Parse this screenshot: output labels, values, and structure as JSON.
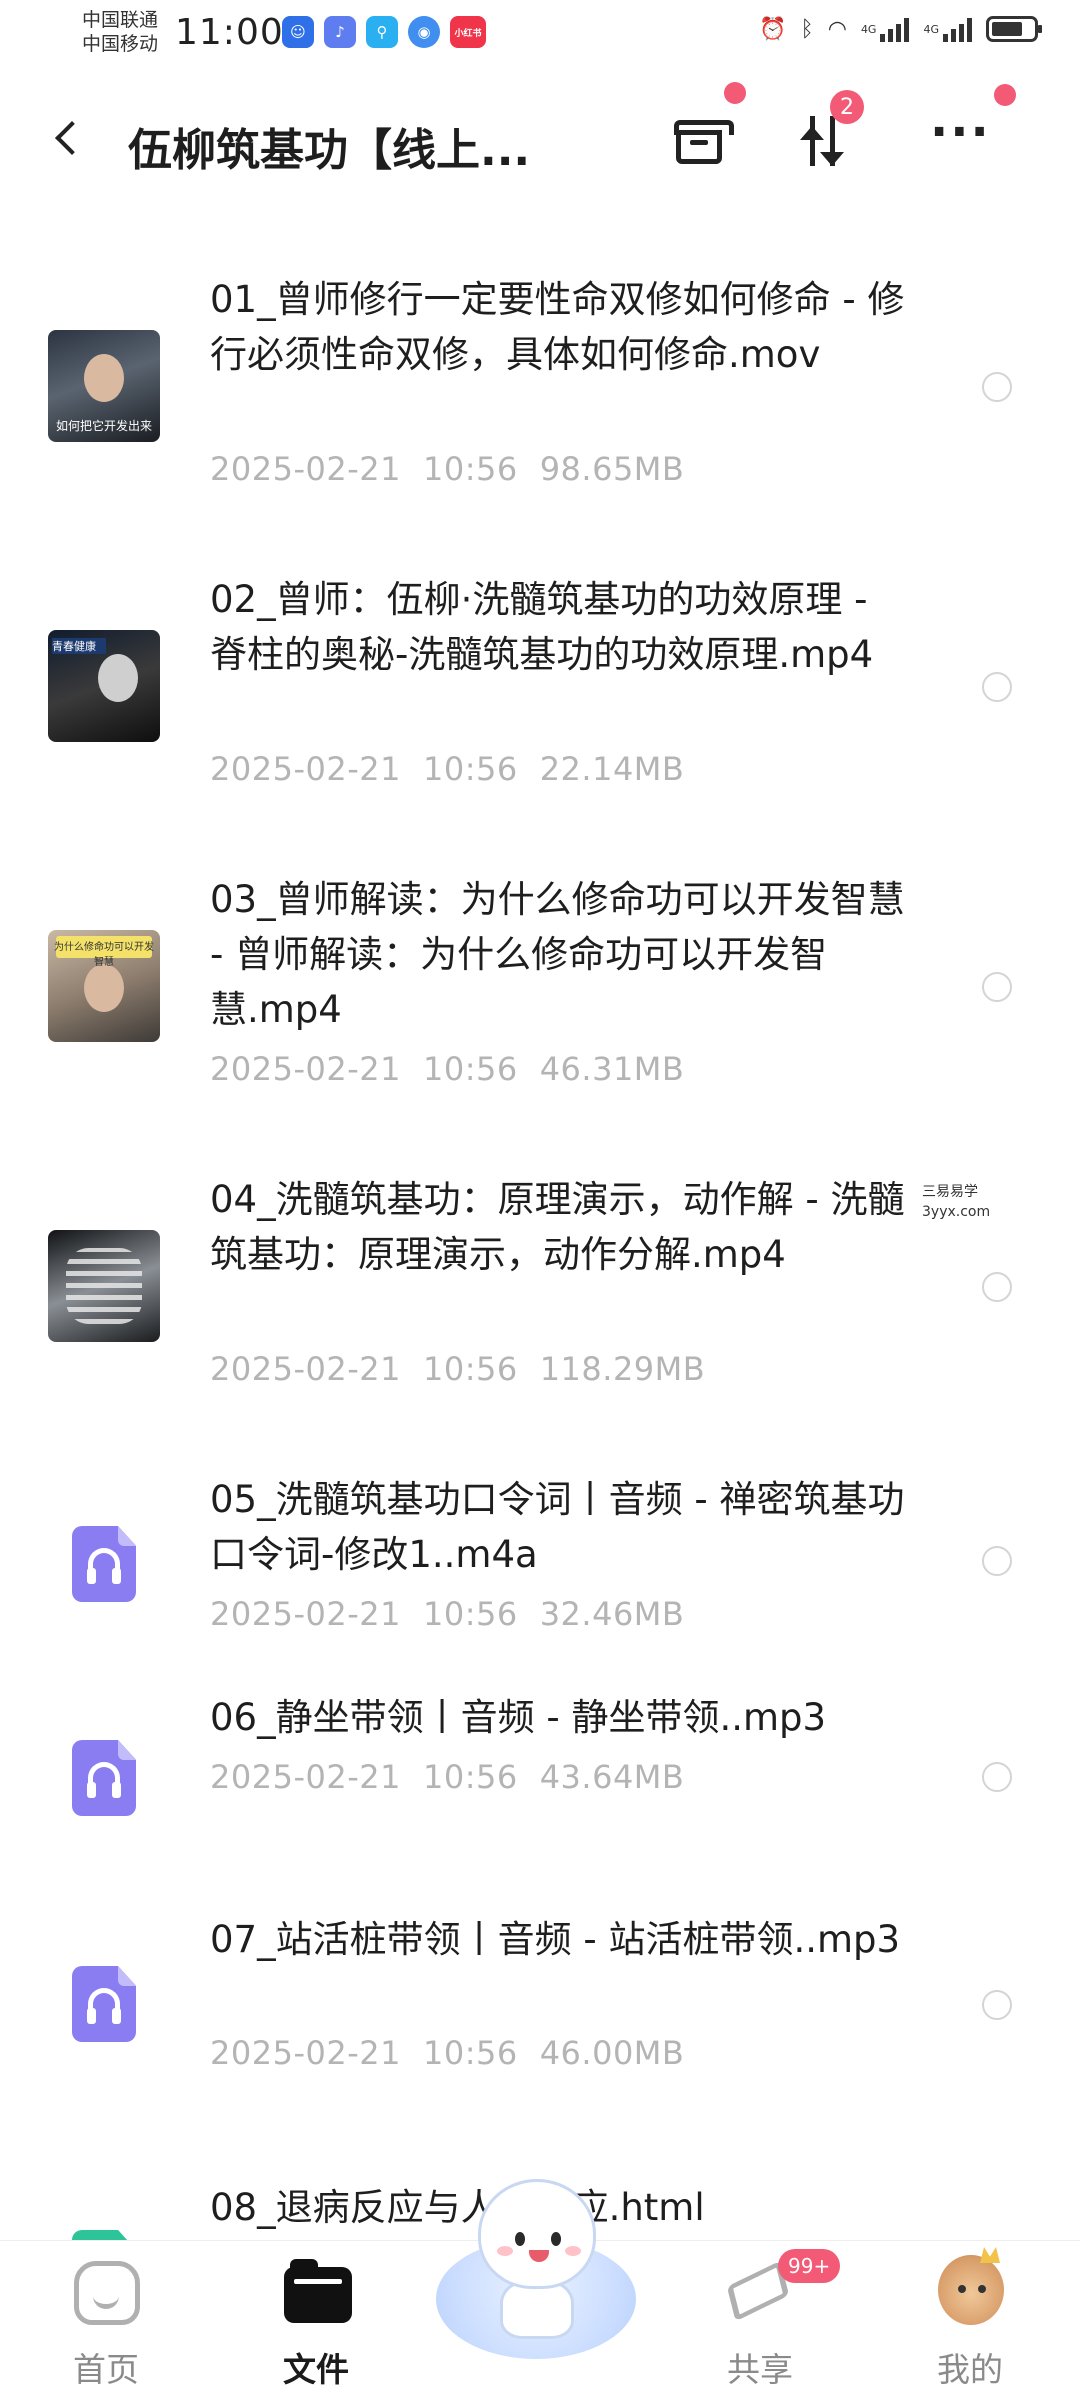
{
  "status_bar": {
    "carrier_1": "中国联通",
    "carrier_2": "中国移动",
    "time": "11:00",
    "app_icons": [
      "notification-app-icon",
      "music-app-icon",
      "search-app-icon",
      "browser-app-icon",
      "xiaohongshu-app-icon"
    ],
    "xiaohongshu_label": "小红书",
    "network_label_1": "4G",
    "network_label_2": "4G"
  },
  "header": {
    "title": "伍柳筑基功【线上...",
    "sort_badge": "2",
    "more_icon": "···"
  },
  "files": [
    {
      "name": "01_曾师修行一定要性命双修如何修命 - 修行必须性命双修，具体如何修命.mov",
      "date": "2025-02-21",
      "time": "10:56",
      "size": "98.65MB",
      "type": "video",
      "thumb_caption": "如何把它开发出来"
    },
    {
      "name": "02_曾师：伍柳·洗髓筑基功的功效原理 - 脊柱的奥秘-洗髓筑基功的功效原理.mp4",
      "date": "2025-02-21",
      "time": "10:56",
      "size": "22.14MB",
      "type": "video",
      "thumb_caption": "青春健康"
    },
    {
      "name": "03_曾师解读：为什么修命功可以开发智慧 - 曾师解读：为什么修命功可以开发智慧.mp4",
      "date": "2025-02-21",
      "time": "10:56",
      "size": "46.31MB",
      "type": "video",
      "thumb_caption": "为什么修命功可以开发智慧"
    },
    {
      "name": "04_洗髓筑基功：原理演示，动作解 - 洗髓筑基功：原理演示，动作分解.mp4",
      "date": "2025-02-21",
      "time": "10:56",
      "size": "118.29MB",
      "type": "video",
      "thumb_caption": ""
    },
    {
      "name": "05_洗髓筑基功口令词丨音频 - 禅密筑基功口令词-修改1..m4a",
      "date": "2025-02-21",
      "time": "10:56",
      "size": "32.46MB",
      "type": "audio"
    },
    {
      "name": "06_静坐带领丨音频 - 静坐带领..mp3",
      "date": "2025-02-21",
      "time": "10:56",
      "size": "43.64MB",
      "type": "audio"
    },
    {
      "name": "07_站活桩带领丨音频 - 站活桩带领..mp3",
      "date": "2025-02-21",
      "time": "10:56",
      "size": "46.00MB",
      "type": "audio"
    },
    {
      "name": "08_退病反应与人生反应.html",
      "type": "html",
      "icon_text": "</>"
    }
  ],
  "watermark": {
    "line1": "三易易学",
    "line2": "3yyx.com"
  },
  "bottom_nav": {
    "items": [
      {
        "label": "首页",
        "icon": "home-icon"
      },
      {
        "label": "文件",
        "icon": "folder-icon",
        "active": true
      },
      {
        "label": "",
        "icon": "mascot-icon"
      },
      {
        "label": "共享",
        "icon": "share-icon",
        "badge": "99+"
      },
      {
        "label": "我的",
        "icon": "avatar-icon"
      }
    ]
  },
  "colors": {
    "accent": "#f25a75",
    "audio_icon": "#8a7df2",
    "html_icon": "#2ec49a",
    "meta_text": "#b4b4b4"
  }
}
